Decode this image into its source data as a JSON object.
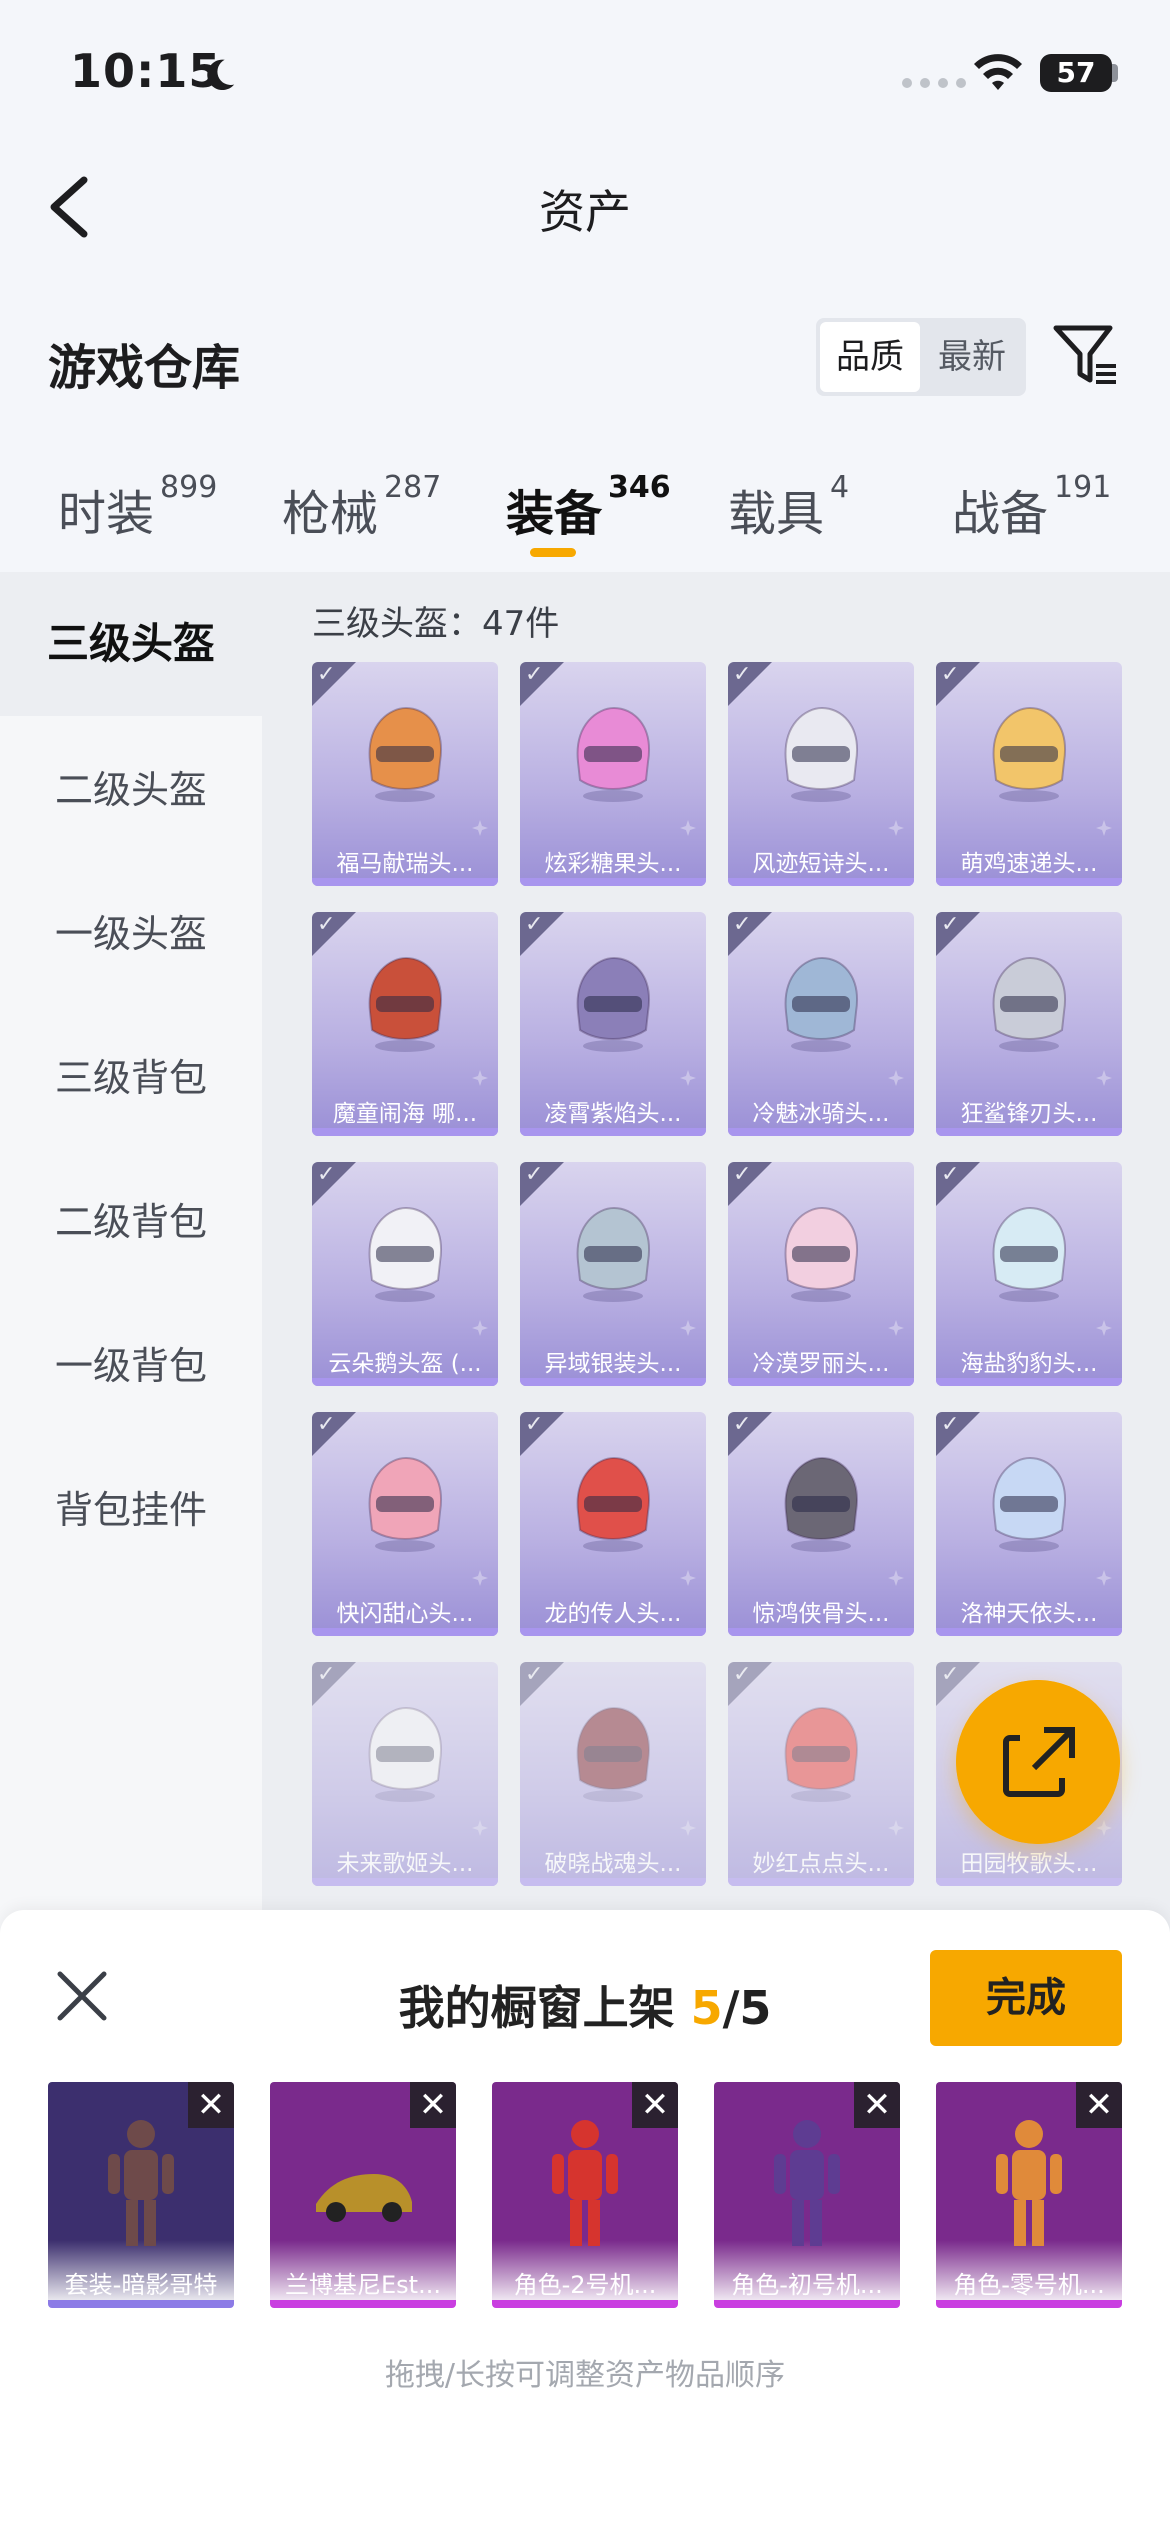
{
  "status_bar": {
    "time": "10:15",
    "battery": "57"
  },
  "nav": {
    "title": "资产"
  },
  "section": {
    "title": "游戏仓库",
    "sort_options": [
      "品质",
      "最新"
    ]
  },
  "tabs": [
    {
      "label": "时装",
      "count": "899"
    },
    {
      "label": "枪械",
      "count": "287"
    },
    {
      "label": "装备",
      "count": "346"
    },
    {
      "label": "载具",
      "count": "4"
    },
    {
      "label": "战备",
      "count": "191"
    }
  ],
  "sidebar": {
    "items": [
      {
        "label": "三级头盔"
      },
      {
        "label": "二级头盔"
      },
      {
        "label": "一级头盔"
      },
      {
        "label": "三级背包"
      },
      {
        "label": "二级背包"
      },
      {
        "label": "一级背包"
      },
      {
        "label": "背包挂件"
      }
    ]
  },
  "grid": {
    "count_label": "三级头盔：47件",
    "items": [
      {
        "label": "福马献瑞头...",
        "color": "#e6904a"
      },
      {
        "label": "炫彩糖果头...",
        "color": "#e88bd6"
      },
      {
        "label": "风迹短诗头...",
        "color": "#e9e9f1"
      },
      {
        "label": "萌鸡速递头...",
        "color": "#f2c56a"
      },
      {
        "label": "魔童闹海 哪...",
        "color": "#c9503a"
      },
      {
        "label": "凌霄紫焰头...",
        "color": "#8b7fb8"
      },
      {
        "label": "冷魅冰骑头...",
        "color": "#9fb7d6"
      },
      {
        "label": "狂鲨锋刃头...",
        "color": "#c9ccd8"
      },
      {
        "label": "云朵鹅头盔 (...",
        "color": "#f1f1f6"
      },
      {
        "label": "异域银装头...",
        "color": "#b4c4d2"
      },
      {
        "label": "冷漠罗丽头...",
        "color": "#f2cfe0"
      },
      {
        "label": "海盐豹豹头...",
        "color": "#d7ebf4"
      },
      {
        "label": "快闪甜心头...",
        "color": "#f0a5b8"
      },
      {
        "label": "龙的传人头...",
        "color": "#e0504a"
      },
      {
        "label": "惊鸿侠骨头...",
        "color": "#6b6775"
      },
      {
        "label": "洛神天依头...",
        "color": "#c7d8f4"
      },
      {
        "label": "未来歌姬头...",
        "color": "#f1f1f5"
      },
      {
        "label": "破晓战魂头...",
        "color": "#8a3a44"
      },
      {
        "label": "妙红点点头...",
        "color": "#e6504e"
      },
      {
        "label": "田园牧歌头...",
        "color": "#d9d0b0"
      }
    ]
  },
  "showcase": {
    "title_prefix": "我的橱窗上架 ",
    "count_current": "5",
    "count_total": "/5",
    "done_label": "完成",
    "slots": [
      {
        "label": "套装-暗影哥特",
        "bg": "#3c2f6e",
        "bar": "#8c7be6",
        "figure": "#6e4a4a"
      },
      {
        "label": "兰博基尼Est...",
        "bg": "#7a2a8c",
        "bar": "#c93ee0",
        "figure": "#b8902a"
      },
      {
        "label": "角色-2号机...",
        "bg": "#7a2a8c",
        "bar": "#c93ee0",
        "figure": "#d6342e"
      },
      {
        "label": "角色-初号机...",
        "bg": "#7a2a8c",
        "bar": "#c93ee0",
        "figure": "#5e3c92"
      },
      {
        "label": "角色-零号机...",
        "bg": "#7a2a8c",
        "bar": "#c93ee0",
        "figure": "#e08a3a"
      }
    ],
    "hint": "拖拽/长按可调整资产物品顺序"
  },
  "colors": {
    "accent": "#f7a800"
  }
}
